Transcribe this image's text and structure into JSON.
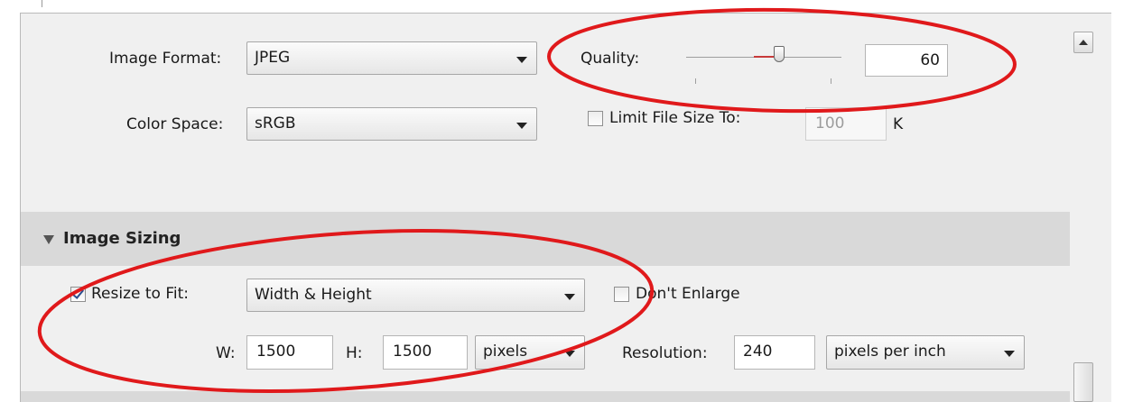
{
  "file_settings": {
    "image_format_label": "Image Format:",
    "image_format_value": "JPEG",
    "quality_label": "Quality:",
    "quality_value": "60",
    "quality_level": 0.6,
    "color_space_label": "Color Space:",
    "color_space_value": "sRGB",
    "limit_file_size_label": "Limit File Size To:",
    "limit_file_size_checked": false,
    "limit_file_size_value": "100",
    "limit_file_size_unit": "K"
  },
  "image_sizing": {
    "title": "Image Sizing",
    "resize_to_fit_label": "Resize to Fit:",
    "resize_to_fit_checked": true,
    "resize_mode_value": "Width & Height",
    "dont_enlarge_label": "Don't Enlarge",
    "dont_enlarge_checked": false,
    "width_label": "W:",
    "width_value": "1500",
    "height_label": "H:",
    "height_value": "1500",
    "units_value": "pixels",
    "resolution_label": "Resolution:",
    "resolution_value": "240",
    "resolution_units_value": "pixels per inch"
  },
  "colors": {
    "annotation_red": "#e0191b",
    "panel_bg": "#f0f0f0",
    "section_header_bg": "#d9d9d9"
  },
  "icons": {
    "section_toggle": "triangle-down-icon",
    "dropdown": "chevron-down-icon",
    "scroll_up": "scroll-up-arrow-icon"
  }
}
